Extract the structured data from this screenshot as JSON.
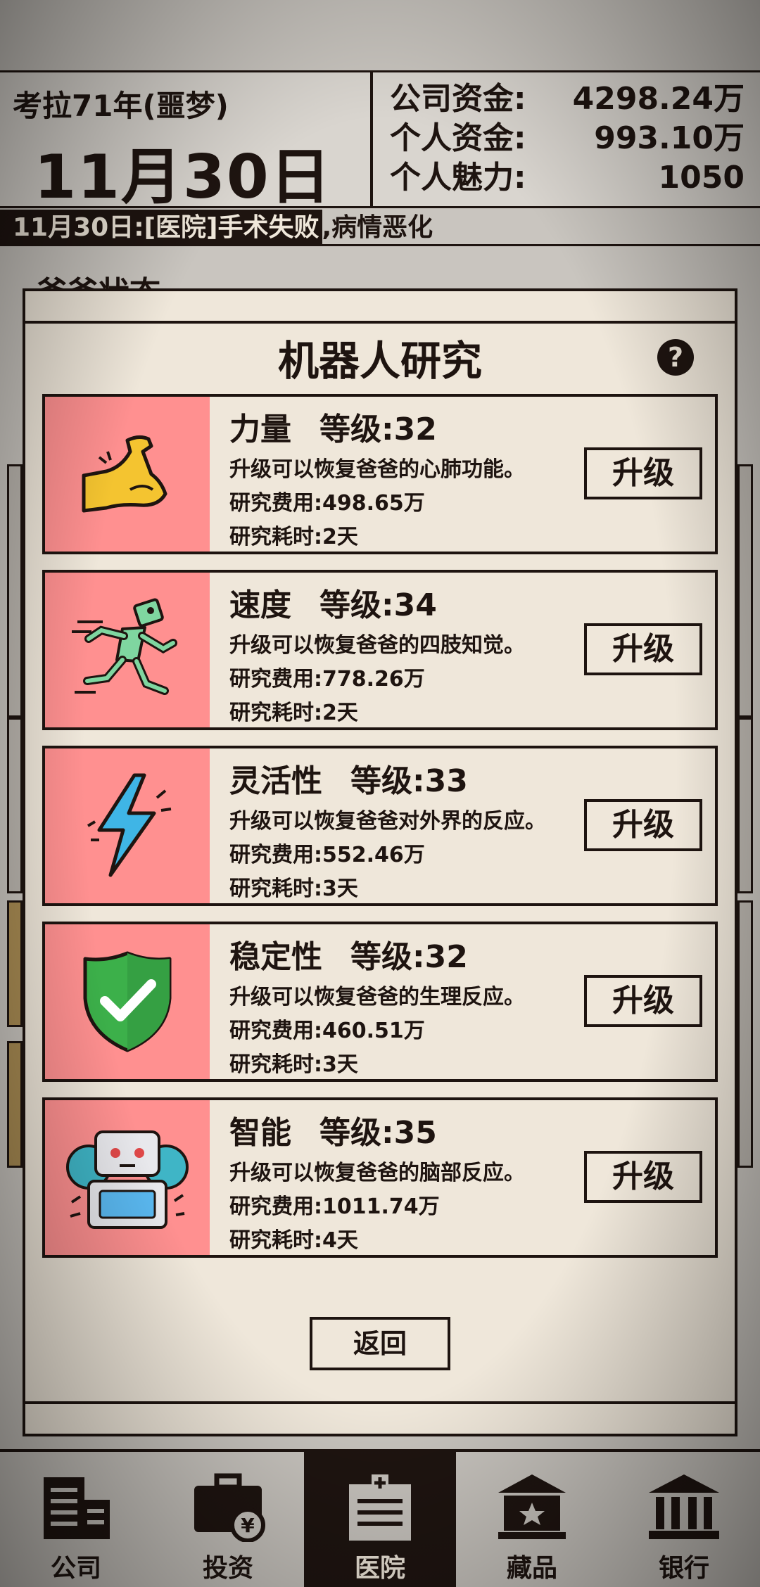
{
  "header": {
    "era": "考拉71年(噩梦)",
    "date": "11月30日",
    "stats": [
      {
        "label": "公司资金:",
        "value": "4298.24万"
      },
      {
        "label": "个人资金:",
        "value": "993.10万"
      },
      {
        "label": "个人魅力:",
        "value": "1050"
      }
    ],
    "news_highlight": "11月30日:[医院]手术失败",
    "news_rest": ",病情恶化",
    "behind_title": "爸爸状态"
  },
  "modal": {
    "title": "机器人研究",
    "help_glyph": "?",
    "back_label": "返回",
    "items": [
      {
        "name": "力量",
        "level": "等级:32",
        "desc": "升级可以恢复爸爸的心肺功能。",
        "cost": "研究费用:498.65万",
        "time": "研究耗时:2天",
        "button": "升级",
        "icon": "muscle-arm-icon"
      },
      {
        "name": "速度",
        "level": "等级:34",
        "desc": "升级可以恢复爸爸的四肢知觉。",
        "cost": "研究费用:778.26万",
        "time": "研究耗时:2天",
        "button": "升级",
        "icon": "running-robot-icon"
      },
      {
        "name": "灵活性",
        "level": "等级:33",
        "desc": "升级可以恢复爸爸对外界的反应。",
        "cost": "研究费用:552.46万",
        "time": "研究耗时:3天",
        "button": "升级",
        "icon": "lightning-icon"
      },
      {
        "name": "稳定性",
        "level": "等级:32",
        "desc": "升级可以恢复爸爸的生理反应。",
        "cost": "研究费用:460.51万",
        "time": "研究耗时:3天",
        "button": "升级",
        "icon": "shield-check-icon"
      },
      {
        "name": "智能",
        "level": "等级:35",
        "desc": "升级可以恢复爸爸的脑部反应。",
        "cost": "研究费用:1011.74万",
        "time": "研究耗时:4天",
        "button": "升级",
        "icon": "robot-gear-icon"
      }
    ]
  },
  "nav": [
    {
      "label": "公司",
      "icon": "company-building-icon",
      "active": false
    },
    {
      "label": "投资",
      "icon": "briefcase-yen-icon",
      "active": false
    },
    {
      "label": "医院",
      "icon": "hospital-icon",
      "active": true
    },
    {
      "label": "藏品",
      "icon": "museum-star-icon",
      "active": false
    },
    {
      "label": "银行",
      "icon": "bank-icon",
      "active": false
    }
  ],
  "colors": {
    "ink": "#1e1410",
    "paper": "#efe7da",
    "icon_bg": "#ff9090",
    "background": "#c9c5bf"
  }
}
